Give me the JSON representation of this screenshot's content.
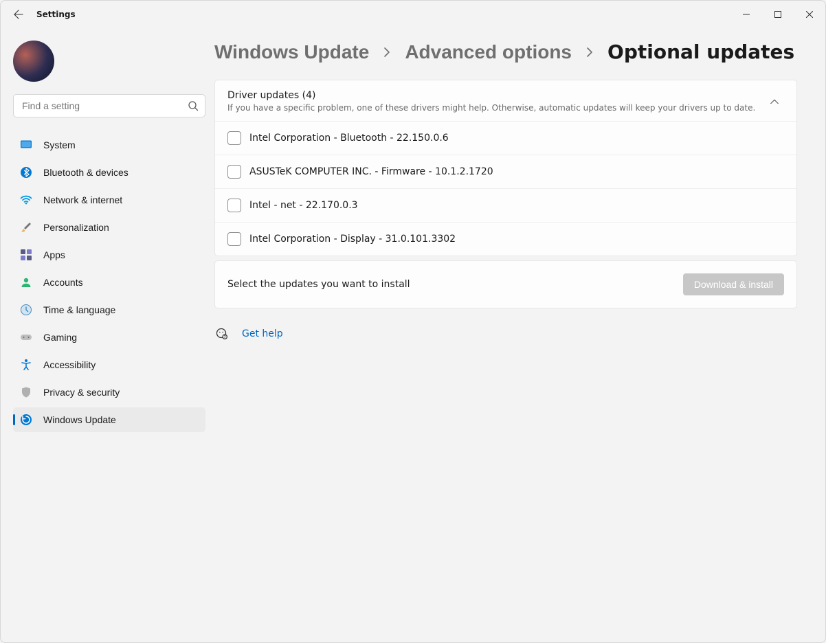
{
  "window": {
    "title": "Settings"
  },
  "search": {
    "placeholder": "Find a setting"
  },
  "sidebar": {
    "items": [
      {
        "label": "System",
        "active": false
      },
      {
        "label": "Bluetooth & devices",
        "active": false
      },
      {
        "label": "Network & internet",
        "active": false
      },
      {
        "label": "Personalization",
        "active": false
      },
      {
        "label": "Apps",
        "active": false
      },
      {
        "label": "Accounts",
        "active": false
      },
      {
        "label": "Time & language",
        "active": false
      },
      {
        "label": "Gaming",
        "active": false
      },
      {
        "label": "Accessibility",
        "active": false
      },
      {
        "label": "Privacy & security",
        "active": false
      },
      {
        "label": "Windows Update",
        "active": true
      }
    ]
  },
  "breadcrumb": {
    "crumbs": [
      {
        "text": "Windows Update",
        "current": false
      },
      {
        "text": "Advanced options",
        "current": false
      },
      {
        "text": "Optional updates",
        "current": true
      }
    ]
  },
  "driver_card": {
    "title": "Driver updates (4)",
    "subtitle": "If you have a specific problem, one of these drivers might help. Otherwise, automatic updates will keep your drivers up to date.",
    "items": [
      "Intel Corporation - Bluetooth - 22.150.0.6",
      "ASUSTeK COMPUTER INC. - Firmware - 10.1.2.1720",
      "Intel - net - 22.170.0.3",
      "Intel Corporation - Display - 31.0.101.3302"
    ]
  },
  "footer": {
    "message": "Select the updates you want to install",
    "button": "Download & install"
  },
  "help": {
    "label": "Get help"
  },
  "colors": {
    "accent": "#0067c0",
    "bg": "#f3f3f3",
    "card": "#fdfdfd"
  }
}
